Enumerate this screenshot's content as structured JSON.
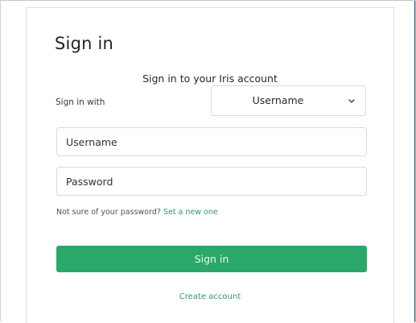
{
  "signin": {
    "title": "Sign in",
    "subtitle": "Sign in to your Iris account",
    "method_label": "Sign in with",
    "method_selected": "Username",
    "username_placeholder": "Username",
    "password_placeholder": "Password",
    "forgot_prefix": "Not sure of your password? ",
    "forgot_link": "Set a new one",
    "submit_label": "Sign in",
    "create_account_label": "Create account"
  },
  "icons": {
    "select_chevron": "chevron-down-icon"
  },
  "colors": {
    "accent": "#2aa86a",
    "link": "#2f9a63",
    "border": "#d6dadf"
  }
}
